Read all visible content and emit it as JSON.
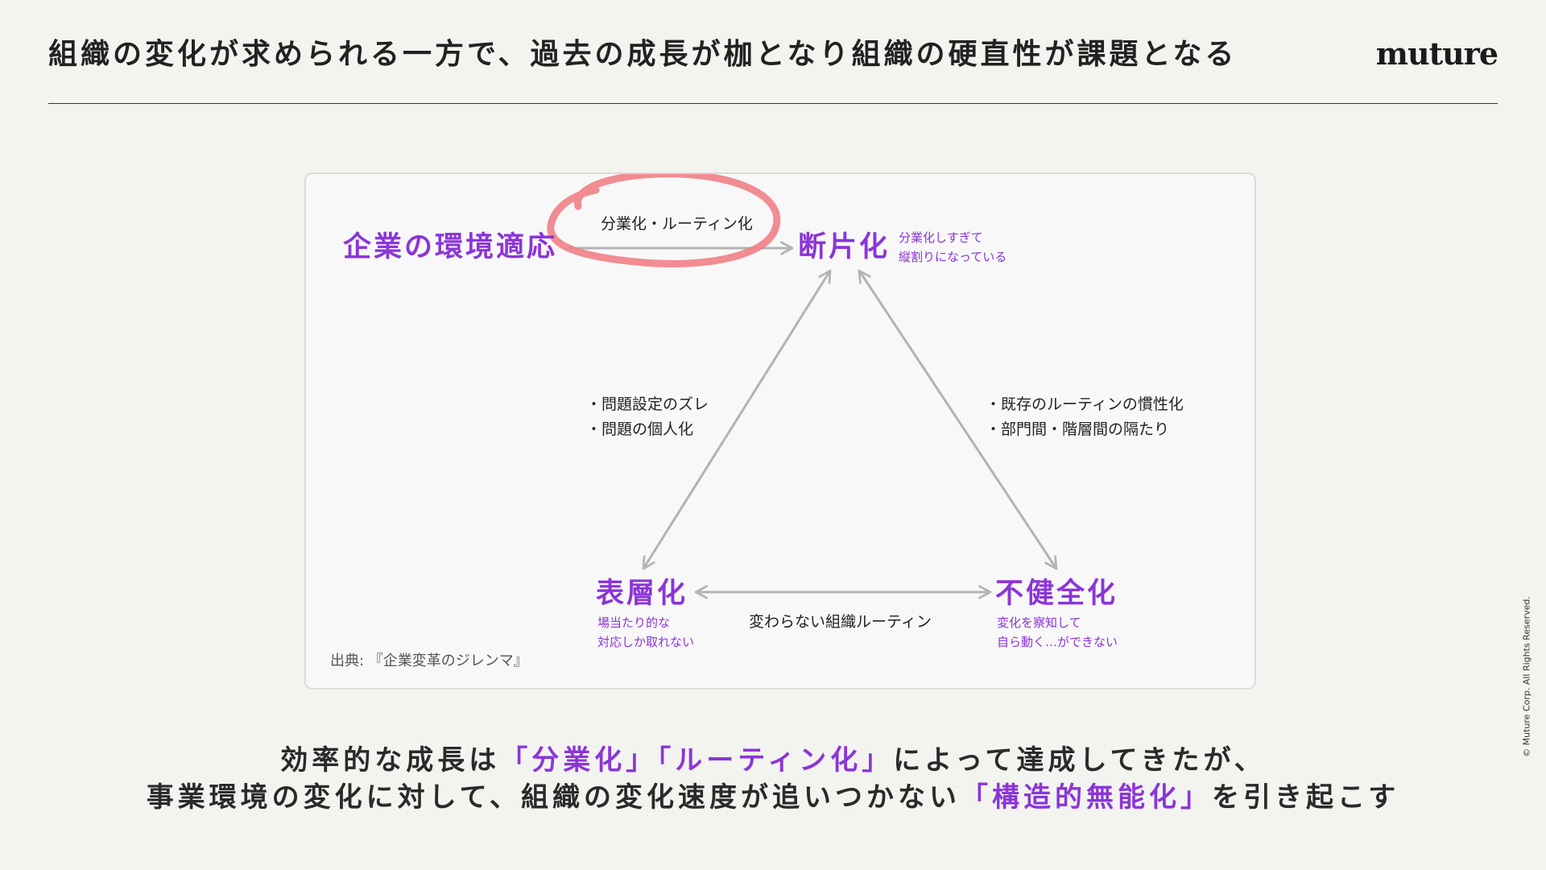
{
  "header": {
    "title": "組織の変化が求められる一方で、過去の成長が枷となり組織の硬直性が課題となる",
    "logo_text": "muture"
  },
  "diagram": {
    "start_node": "企業の環境適応",
    "start_edge_label": "分業化・ルーティン化",
    "top_node": {
      "title": "断片化",
      "sub": [
        "分業化しすぎて",
        "縦割りになっている"
      ]
    },
    "left_node": {
      "title": "表層化",
      "sub": [
        "場当たり的な",
        "対応しか取れない"
      ]
    },
    "right_node": {
      "title": "不健全化",
      "sub": [
        "変化を察知して",
        "自ら動く…ができない"
      ]
    },
    "left_edge_notes": [
      "・問題設定のズレ",
      "・問題の個人化"
    ],
    "right_edge_notes": [
      "・既存のルーティンの慣性化",
      "・部門間・階層間の隔たり"
    ],
    "bottom_edge_label": "変わらない組織ルーティン",
    "source": "出典: 『企業変革のジレンマ』"
  },
  "conclusion": {
    "line1_a": "効率的な成長は",
    "line1_hl": "「分業化」「ルーティン化」",
    "line1_b": "によって達成してきたが、",
    "line2_a": "事業環境の変化に対して、組織の変化速度が追いつかない",
    "line2_hl": "「構造的無能化」",
    "line2_b": "を引き起こす"
  },
  "footer": {
    "copyright": "© Muture Corp. All Rights Reserved."
  },
  "colors": {
    "accent": "#8b35d8",
    "highlight_circle": "#ef7f86",
    "arrow": "#b3b3b3",
    "background": "#f3f3f0"
  }
}
